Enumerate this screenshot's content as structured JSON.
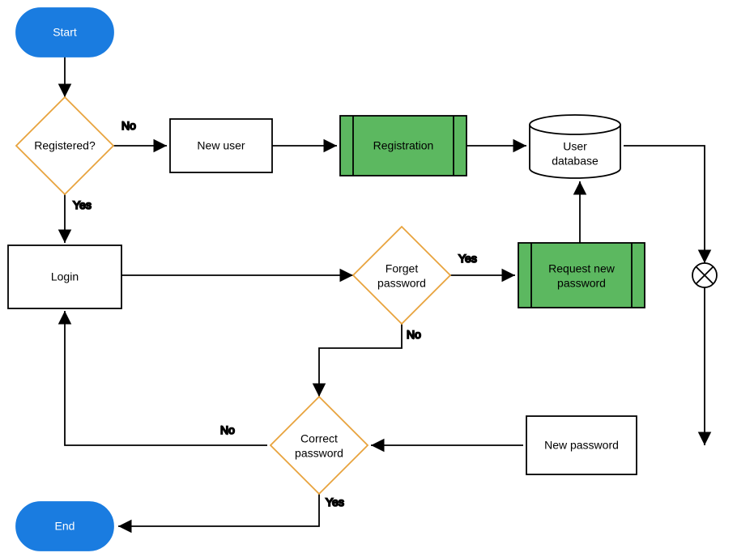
{
  "nodes": {
    "start": "Start",
    "end": "End",
    "registered": "Registered?",
    "new_user": "New user",
    "registration": "Registration",
    "user_db_l1": "User",
    "user_db_l2": "database",
    "login": "Login",
    "forget_l1": "Forget",
    "forget_l2": "password",
    "req_l1": "Request new",
    "req_l2": "password",
    "new_password": "New password",
    "correct_l1": "Correct",
    "correct_l2": "password"
  },
  "edges": {
    "registered_no": "No",
    "registered_yes": "Yes",
    "forget_yes": "Yes",
    "forget_no": "No",
    "correct_no": "No",
    "correct_yes": "Yes"
  },
  "colors": {
    "terminator_fill": "#1a7ce0",
    "terminator_stroke": "#1a7ce0",
    "decision_stroke": "#e8a33d",
    "subprocess_fill": "#5cb860",
    "rect_stroke": "#000000",
    "line": "#000000"
  }
}
